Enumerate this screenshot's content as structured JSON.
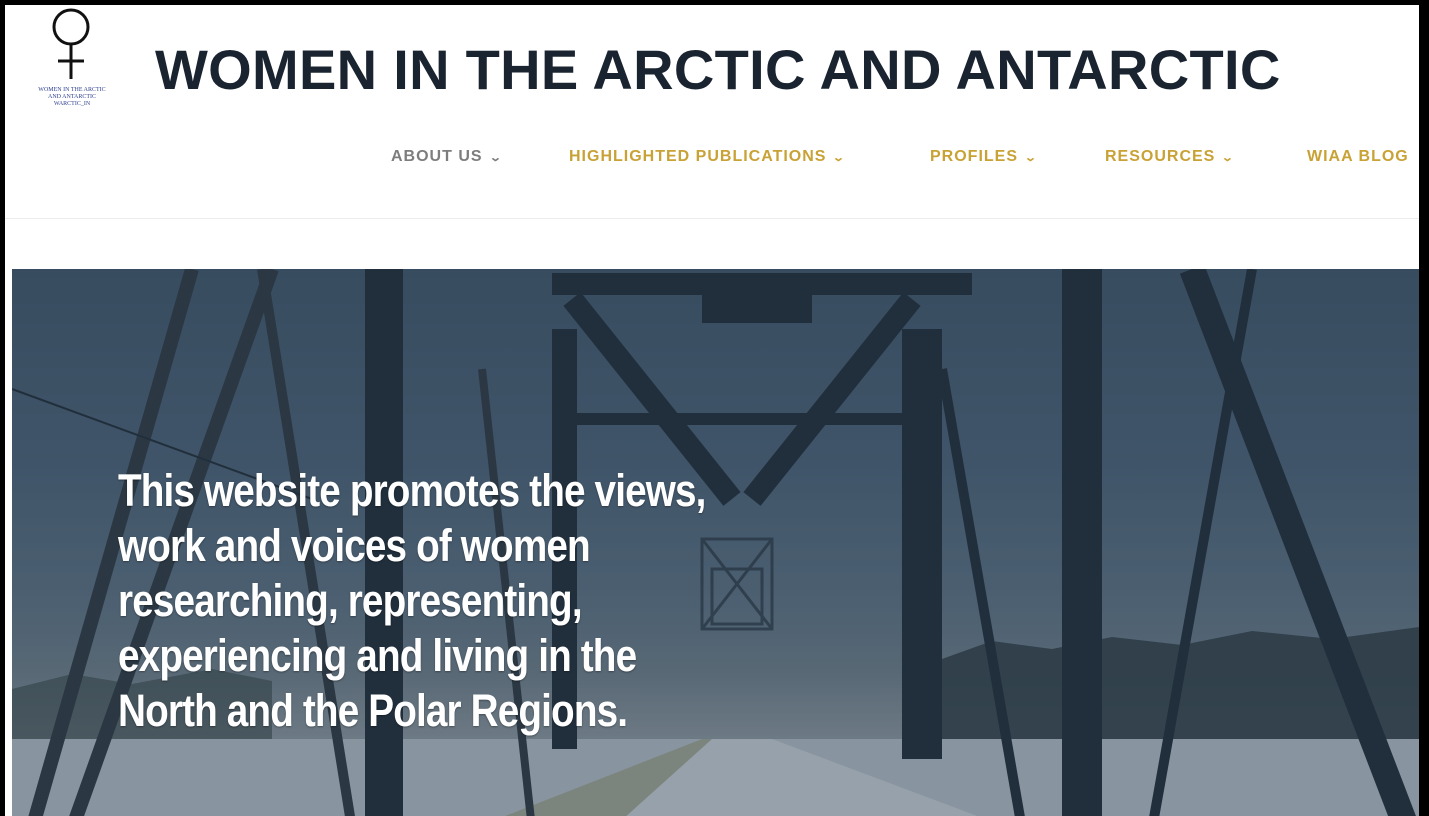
{
  "header": {
    "title": "WOMEN IN THE ARCTIC AND ANTARCTIC",
    "logo": {
      "symbol": "venus-symbol-icon",
      "text_lines": [
        "WOMEN IN THE ARCTIC",
        "AND ANTARCTIC",
        "WARCTIC_IN"
      ]
    }
  },
  "nav": {
    "items": [
      {
        "label": "ABOUT US",
        "has_dropdown": true
      },
      {
        "label": "HIGHLIGHTED PUBLICATIONS",
        "has_dropdown": true
      },
      {
        "label": "PROFILES",
        "has_dropdown": true
      },
      {
        "label": "RESOURCES",
        "has_dropdown": true
      },
      {
        "label": "WIAA BLOG",
        "has_dropdown": false
      }
    ],
    "dropdown_icon": "chevron-down-icon"
  },
  "hero": {
    "text_lines": [
      "This website promotes the views,",
      "work and voices of women",
      "researching, representing,",
      "experiencing and living in the",
      "North and the Polar Regions."
    ],
    "background": "steel truss bridge in winter"
  },
  "colors": {
    "title": "#1a2430",
    "nav_active": "#7d7d7d",
    "nav_accent": "#c9a236",
    "hero_overlay": "#3e5266",
    "frame": "#000000"
  }
}
